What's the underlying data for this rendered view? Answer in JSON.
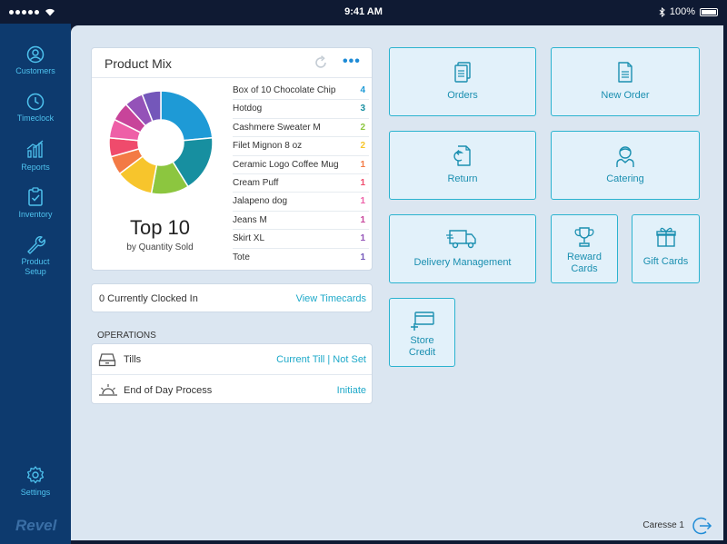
{
  "status_bar": {
    "time": "9:41 AM",
    "battery": "100%"
  },
  "sidebar": {
    "items": [
      {
        "label": "Customers",
        "icon": "user-circle-icon"
      },
      {
        "label": "Timeclock",
        "icon": "clock-icon"
      },
      {
        "label": "Reports",
        "icon": "bar-chart-icon"
      },
      {
        "label": "Inventory",
        "icon": "clipboard-check-icon"
      },
      {
        "label": "Product Setup",
        "icon": "wrench-icon"
      },
      {
        "label": "Settings",
        "icon": "gear-icon"
      }
    ],
    "brand": "Revel"
  },
  "product_mix": {
    "title": "Product Mix",
    "top_title": "Top 10",
    "top_subtitle": "by Quantity Sold",
    "items": [
      {
        "name": "Box of 10 Chocolate Chip",
        "qty": "4",
        "color": "#1e9ad6"
      },
      {
        "name": "Hotdog",
        "qty": "3",
        "color": "#178fa0"
      },
      {
        "name": "Cashmere Sweater M",
        "qty": "2",
        "color": "#8cc63f"
      },
      {
        "name": "Filet Mignon 8 oz",
        "qty": "2",
        "color": "#f7c52c"
      },
      {
        "name": "Ceramic Logo Coffee Mug",
        "qty": "1",
        "color": "#f37a45"
      },
      {
        "name": "Cream Puff",
        "qty": "1",
        "color": "#ef4b6c"
      },
      {
        "name": "Jalapeno dog",
        "qty": "1",
        "color": "#ee5fa7"
      },
      {
        "name": "Jeans M",
        "qty": "1",
        "color": "#c8449a"
      },
      {
        "name": "Skirt XL",
        "qty": "1",
        "color": "#9452b8"
      },
      {
        "name": "Tote",
        "qty": "1",
        "color": "#7457ba"
      }
    ]
  },
  "clocked_in": {
    "label": "0 Currently Clocked In",
    "link": "View Timecards"
  },
  "operations": {
    "title": "OPERATIONS",
    "rows": [
      {
        "label": "Tills",
        "value": "Current Till | Not Set",
        "icon": "till-icon"
      },
      {
        "label": "End of Day Process",
        "value": "Initiate",
        "icon": "sunset-icon"
      }
    ]
  },
  "tiles": {
    "orders": "Orders",
    "new_order": "New Order",
    "return": "Return",
    "catering": "Catering",
    "delivery": "Delivery Management",
    "reward_cards": "Reward Cards",
    "gift_cards": "Gift Cards",
    "store_credit": "Store Credit"
  },
  "footer": {
    "user": "Caresse 1"
  },
  "colors": {
    "accent": "#2bb3cf",
    "sidebar": "#0d3a6e",
    "tile_bg": "#e2f1fa"
  }
}
